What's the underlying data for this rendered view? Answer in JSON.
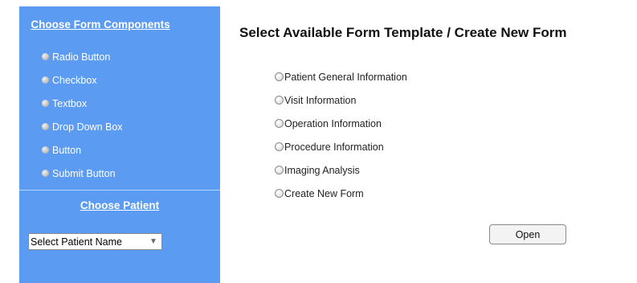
{
  "sidebar": {
    "components_title": "Choose Form Components",
    "components": [
      {
        "label": "Radio Button"
      },
      {
        "label": "Checkbox"
      },
      {
        "label": "Textbox"
      },
      {
        "label": "Drop Down Box"
      },
      {
        "label": "Button"
      },
      {
        "label": "Submit Button"
      }
    ],
    "patient_title": "Choose Patient",
    "patient_select": {
      "value": "Select Patient Name"
    }
  },
  "main": {
    "title": "Select Available Form Template / Create New Form",
    "templates": [
      {
        "label": "Patient General Information"
      },
      {
        "label": "Visit Information"
      },
      {
        "label": "Operation Information"
      },
      {
        "label": "Procedure Information"
      },
      {
        "label": "Imaging Analysis"
      },
      {
        "label": "Create New Form"
      }
    ],
    "open_label": "Open"
  },
  "colors": {
    "sidebar_bg": "#5b9bf2",
    "sidebar_text": "#ffffff"
  },
  "icons": {
    "component_bullet": "gray-circle-icon",
    "template_radio": "radio-circle-icon",
    "select_arrow": "dropdown-arrow-icon"
  }
}
